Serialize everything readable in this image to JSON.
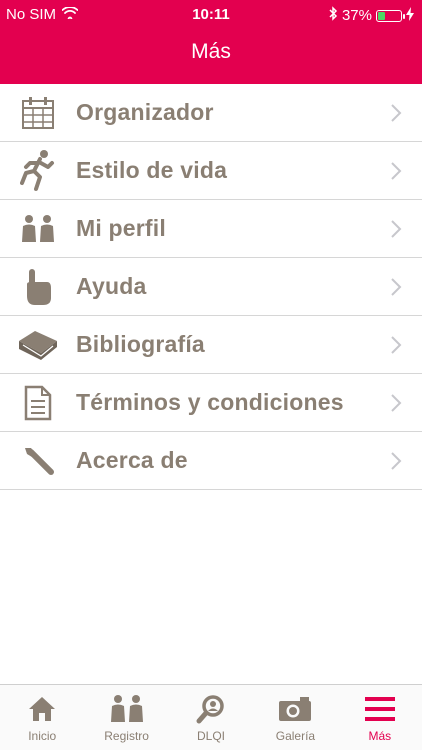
{
  "status_bar": {
    "carrier": "No SIM",
    "time": "10:11",
    "battery": "37%",
    "battery_level": 0.37
  },
  "header": {
    "title": "Más"
  },
  "menu": {
    "items": [
      {
        "label": "Organizador",
        "icon": "calendar-icon"
      },
      {
        "label": "Estilo de vida",
        "icon": "runner-icon"
      },
      {
        "label": "Mi perfil",
        "icon": "people-icon"
      },
      {
        "label": "Ayuda",
        "icon": "pointing-hand-icon"
      },
      {
        "label": "Bibliografía",
        "icon": "book-icon"
      },
      {
        "label": "Términos y condiciones",
        "icon": "document-icon"
      },
      {
        "label": "Acerca de",
        "icon": "wrench-icon"
      }
    ]
  },
  "tabbar": {
    "tabs": [
      {
        "label": "Inicio",
        "icon": "home-icon"
      },
      {
        "label": "Registro",
        "icon": "people-icon"
      },
      {
        "label": "DLQI",
        "icon": "magnifier-face-icon"
      },
      {
        "label": "Galería",
        "icon": "camera-icon"
      },
      {
        "label": "Más",
        "icon": "menu-icon",
        "active": true
      }
    ]
  },
  "colors": {
    "accent": "#e3004f",
    "icon": "#8a7f73",
    "chevron": "#c7c7cc"
  }
}
